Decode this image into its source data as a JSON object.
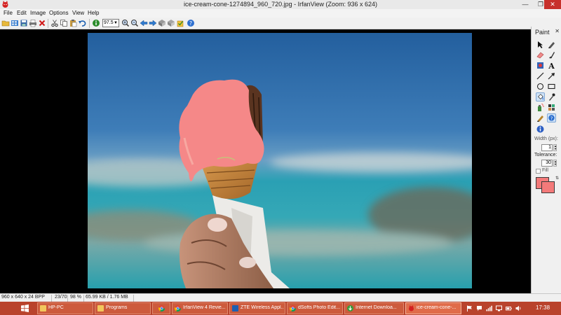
{
  "window": {
    "title": "ice-cream-cone-1274894_960_720.jpg - IrfanView (Zoom: 936 x 624)",
    "icon": "irfanview-red-cat-icon",
    "minimize_glyph": "—",
    "maximize_glyph": "❐",
    "close_glyph": "✕"
  },
  "menu": [
    "File",
    "Edit",
    "Image",
    "Options",
    "View",
    "Help"
  ],
  "toolbar": {
    "zoom_value": "97.5",
    "buttons": [
      "open-icon",
      "thumbnails-icon",
      "save-icon",
      "print-icon",
      "delete-icon",
      "cut-icon",
      "copy-icon",
      "paste-icon",
      "undo-icon",
      "info-icon",
      "zoom-in-icon",
      "zoom-out-icon",
      "previous-icon",
      "next-icon",
      "slideshow-icon",
      "hand-icon",
      "fit-icon",
      "settings-icon",
      "help-icon"
    ]
  },
  "paint": {
    "title": "Paint",
    "close_glyph": "✕",
    "width_label": "Width (px):",
    "width_value": "1",
    "tolerance_label": "Tolerance:",
    "tolerance_value": "30",
    "fill_label": "Fill",
    "foreground_color": "#f47a7a",
    "background_color": "#f47a7a"
  },
  "status": {
    "dimensions": "960 x 640 x 24 BPP",
    "index": "23/70",
    "zoom": "98 %",
    "filesize": "65.99 KB / 1.76 MB"
  },
  "taskbar": {
    "items": [
      {
        "label": "HP-PC",
        "icon": "folder-icon"
      },
      {
        "label": "Programs",
        "icon": "folder-icon"
      },
      {
        "label": "",
        "icon": "chrome-icon"
      },
      {
        "label": "IrfanView 4 Revie...",
        "icon": "chrome-icon"
      },
      {
        "label": "ZTE Wireless Appl...",
        "icon": "zte-icon"
      },
      {
        "label": "dSofts Photo Edit...",
        "icon": "chrome-icon"
      },
      {
        "label": "Internet Downloa...",
        "icon": "idm-icon"
      },
      {
        "label": "ice-cream-cone-...",
        "icon": "irfanview-icon"
      }
    ],
    "clock": "17:38"
  },
  "colors": {
    "taskbar": "#b9432c",
    "paint_color": "#f47a7a",
    "sky": "#2f6eaa",
    "sea": "#2fa6b6"
  }
}
